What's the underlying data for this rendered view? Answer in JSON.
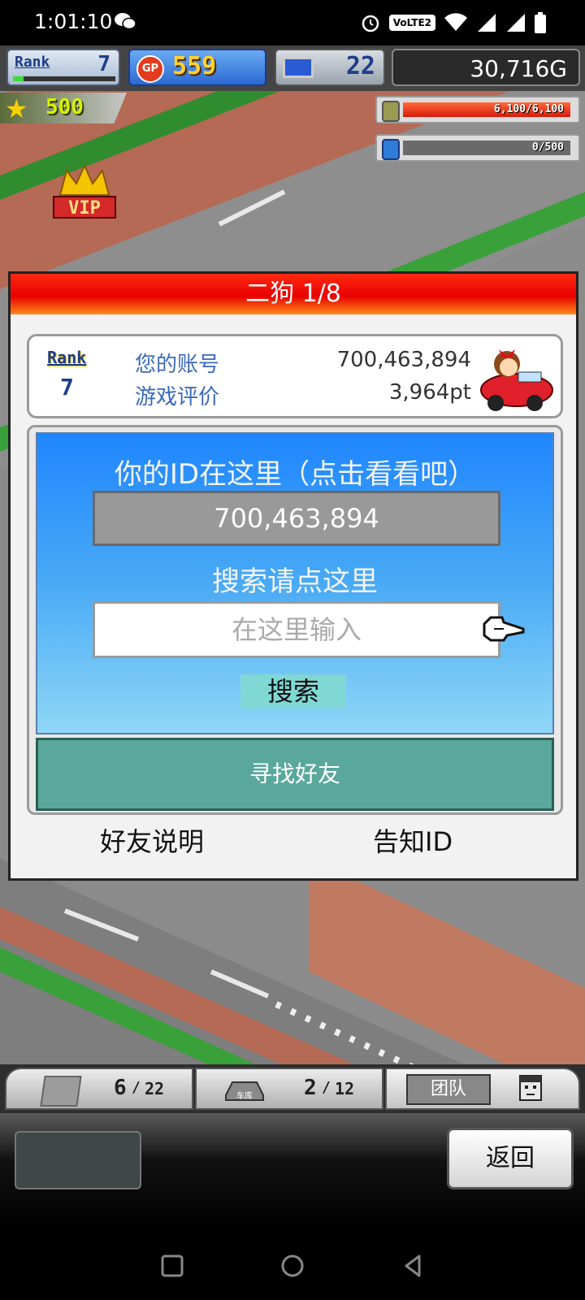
{
  "status_bar": {
    "time": "1:01:10",
    "network": "VoLTE2",
    "icons": [
      "wechat-icon",
      "alarm-icon",
      "wifi-icon",
      "signal-icon",
      "signal-icon",
      "battery-icon"
    ]
  },
  "hud": {
    "rank_label": "Rank",
    "rank_value": "7",
    "rank_progress": 0.1,
    "gp_icon_text": "GP",
    "gp_value": "559",
    "pc_value": "22",
    "money": "30,716G",
    "star_points": "500",
    "fuel_text": "6,100/6,100",
    "fuel_fraction": 1.0,
    "oil_text": "0/500",
    "oil_fraction": 0.0,
    "vip_label": "VIP"
  },
  "dialog": {
    "title": "二狗 1/8",
    "profile": {
      "rank_label": "Rank",
      "rank_value": "7",
      "account_label": "您的账号",
      "account_value": "700,463,894",
      "rating_label": "游戏评价",
      "rating_value": "3,964pt"
    },
    "id_hint": "你的ID在这里（点击看看吧）",
    "id_value": "700,463,894",
    "search_hint": "搜索请点这里",
    "search_placeholder": "在这里输入",
    "search_button": "搜索",
    "find_friends_button": "寻找好友",
    "friend_help_link": "好友说明",
    "notify_id_link": "告知ID"
  },
  "bottom_tabs": {
    "cars_count": "6",
    "cars_total": "22",
    "garage_label": "车库",
    "garage_count": "2",
    "garage_total": "12",
    "team_label": "团队"
  },
  "bottom_bar": {
    "back_button": "返回"
  },
  "colors": {
    "title_red": "#e80000",
    "panel_blue": "#1f86ff",
    "find_teal": "#5aa89c",
    "search_btn": "#7fd8d4"
  }
}
